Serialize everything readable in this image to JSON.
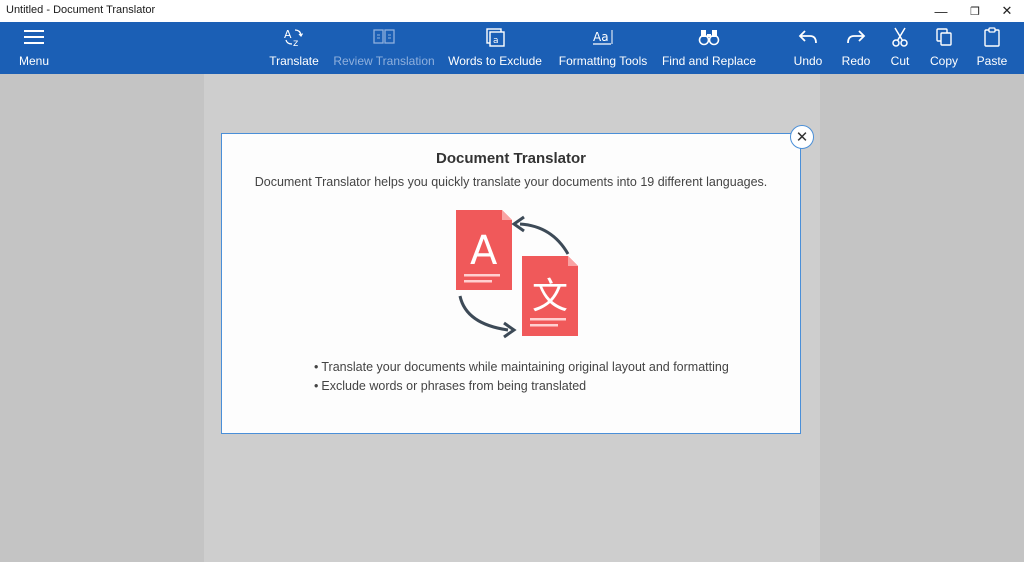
{
  "window": {
    "title": "Untitled - Document Translator",
    "minimize_glyph": "—",
    "maximize_glyph": "❐",
    "close_glyph": "✕"
  },
  "toolbar": {
    "background": "#1b5fb5",
    "items": [
      {
        "id": "menu",
        "label": "Menu",
        "icon": "hamburger-icon",
        "enabled": true
      },
      {
        "id": "translate",
        "label": "Translate",
        "icon": "translate-icon",
        "enabled": true
      },
      {
        "id": "review",
        "label": "Review Translation",
        "icon": "review-icon",
        "enabled": false
      },
      {
        "id": "exclude",
        "label": "Words to Exclude",
        "icon": "exclude-icon",
        "enabled": true
      },
      {
        "id": "formatting",
        "label": "Formatting Tools",
        "icon": "format-icon",
        "enabled": true
      },
      {
        "id": "find",
        "label": "Find and Replace",
        "icon": "binoculars-icon",
        "enabled": true
      },
      {
        "id": "undo",
        "label": "Undo",
        "icon": "undo-icon",
        "enabled": true
      },
      {
        "id": "redo",
        "label": "Redo",
        "icon": "redo-icon",
        "enabled": true
      },
      {
        "id": "cut",
        "label": "Cut",
        "icon": "scissors-icon",
        "enabled": true
      },
      {
        "id": "copy",
        "label": "Copy",
        "icon": "copy-icon",
        "enabled": true
      },
      {
        "id": "paste",
        "label": "Paste",
        "icon": "clipboard-icon",
        "enabled": true
      }
    ]
  },
  "dialog": {
    "title": "Document Translator",
    "subtitle": "Document Translator helps you quickly translate your documents into 19 different languages.",
    "close_glyph": "✕",
    "illustration": {
      "letter_source": "A",
      "letter_target": "文",
      "doc_color": "#f0595a",
      "arrow_color": "#3d4a57"
    },
    "bullets": [
      "Translate your documents while maintaining original layout and formatting",
      "Exclude words or phrases from being translated"
    ]
  }
}
